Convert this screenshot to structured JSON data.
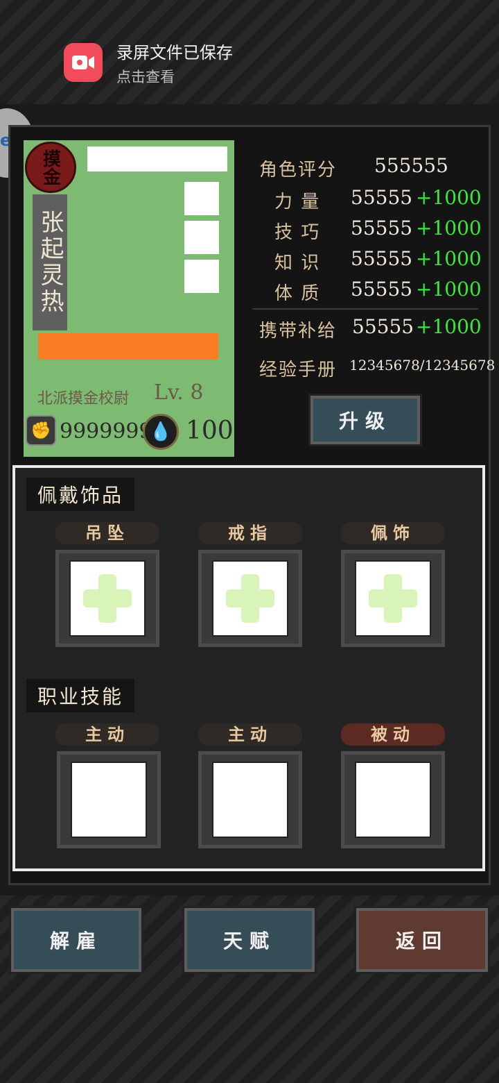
{
  "notification": {
    "icon": "screen-record-icon",
    "title": "录屏文件已保存",
    "subtitle": "点击查看"
  },
  "character": {
    "seal_text": "摸金",
    "name": "张起灵热",
    "title": "北派摸金校尉",
    "level_label": "Lv.",
    "level": "8",
    "currency1": "9999999",
    "currency2": "100"
  },
  "stats": {
    "rating_label": "角色评分",
    "rating_value": "555555",
    "rows": [
      {
        "label": "力 量",
        "value": "55555",
        "bonus": "+1000"
      },
      {
        "label": "技 巧",
        "value": "55555",
        "bonus": "+1000"
      },
      {
        "label": "知 识",
        "value": "55555",
        "bonus": "+1000"
      },
      {
        "label": "体 质",
        "value": "55555",
        "bonus": "+1000"
      }
    ],
    "supply_label": "携带补给",
    "supply_value": "55555",
    "supply_bonus": "+1000",
    "exp_label": "经验手册",
    "exp_value": "12345678/12345678"
  },
  "buttons": {
    "upgrade": "升级",
    "dismiss": "解雇",
    "talent": "天赋",
    "back": "返回"
  },
  "accessories": {
    "title": "佩戴饰品",
    "slots": [
      "吊坠",
      "戒指",
      "佩饰"
    ]
  },
  "skills": {
    "title": "职业技能",
    "slots": [
      "主动",
      "主动",
      "被动"
    ]
  },
  "colors": {
    "portrait_bg": "#7dbb72",
    "bonus_green": "#38e83b",
    "orange_bar": "#fa7d24"
  }
}
